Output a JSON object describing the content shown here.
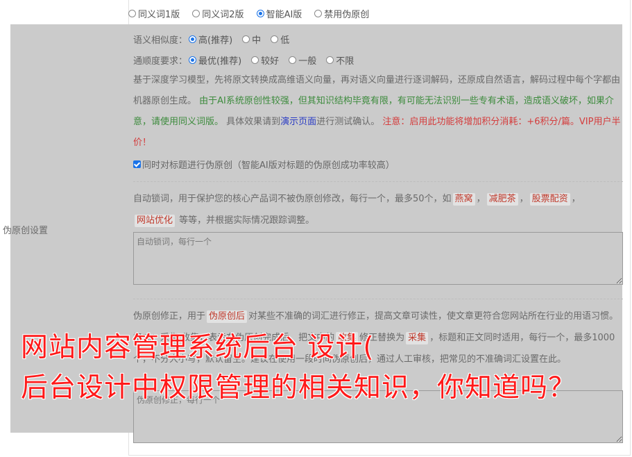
{
  "version_options": [
    {
      "label": "同义词1版",
      "checked": false
    },
    {
      "label": "同义词2版",
      "checked": false
    },
    {
      "label": "智能AI版",
      "checked": true
    },
    {
      "label": "禁用伪原创",
      "checked": false
    }
  ],
  "section_label": "伪原创设置",
  "similarity": {
    "label": "语义相似度：",
    "options": [
      "高(推荐)",
      "中",
      "低"
    ],
    "selected": 0
  },
  "fluency": {
    "label": "通顺度要求：",
    "options": [
      "最优(推荐)",
      "较好",
      "一般",
      "不限"
    ],
    "selected": 0
  },
  "ai_description": {
    "part1": "基于深度学习模型，先将原文转换成高维语义向量，再对语义向量进行逐词解码，还原成自然语言，解码过程中每个字都由机器原创生成。",
    "part2_green": "由于AI系统原创性较强，但其知识结构毕竟有限，有可能无法识别一些专有术语，造成语义破坏，如果介意，请使用同义词版。",
    "part3": "具体效果请到",
    "demo_link": "演示页面",
    "part4": "进行测试确认。",
    "notice_red": "注意：启用此功能将增加积分消耗：+6积分/篇。VIP用户半价！"
  },
  "title_checkbox": {
    "checked": true,
    "label": "同时对标题进行伪原创（智能AI版对标题的伪原创成功率较高）"
  },
  "lock_words": {
    "desc_before": "自动锁词，用于保护您的核心产品词不被伪原创修改，每行一个，最多50个，如",
    "examples": [
      "燕窝",
      "减肥茶",
      "股票配资",
      "网站优化"
    ],
    "desc_after": "等等，并根据实际情况跟踪调整。",
    "placeholder": "自动锁词，每行一个"
  },
  "correction": {
    "desc_before": "伪原创修正，用于",
    "tag1": "伪原创后",
    "desc_mid": "对某些不准确的词汇进行修正，提高文章可读性，使文章更符合您网站所在行业的用语习惯。格式：采集 收集，表示在伪原创完成后，把文中的",
    "tag2": "收集",
    "desc_mid2": "修正替换为",
    "tag3": "采集",
    "desc_after": "，标题和正文同时适用，每行一个，最多1000个，不分大小写，默认留空。建议在使用一段时间伪原创后，通过人工审核，把常见的不准确词汇设置在此。",
    "placeholder": "伪原创修正，每行一个"
  },
  "overlay_title": {
    "line1": "网站内容管理系统后台 设计(",
    "line2": "后台设计中权限管理的相关知识，你知道吗？"
  },
  "colors": {
    "accent": "#1a73e8",
    "green": "#3d8b3d",
    "red": "#d43c3c",
    "overlay": "#ff1a1a"
  }
}
